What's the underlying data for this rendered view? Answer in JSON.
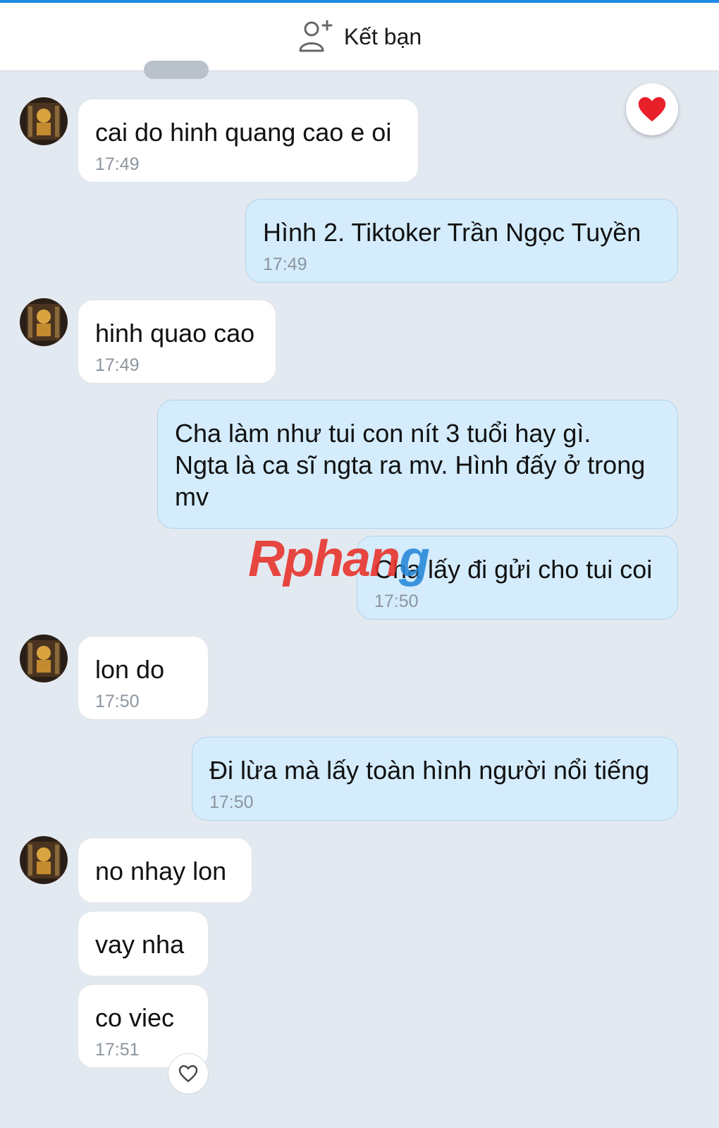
{
  "header": {
    "add_friend_label": "Kết bạn",
    "add_friend_icon": "add-friend-icon"
  },
  "colors": {
    "accent_line": "#1e88e5",
    "chat_background": "#e3e9f0",
    "incoming_bubble": "#ffffff",
    "outgoing_bubble": "#d4ecfc",
    "heart": "#e8202a"
  },
  "messages": [
    {
      "side": "in",
      "text": "cai do hinh quang cao e oi",
      "time": "17:49"
    },
    {
      "side": "out",
      "text": "Hình 2. Tiktoker Trần Ngọc Tuyền",
      "time": "17:49"
    },
    {
      "side": "in",
      "text": "hinh quao cao",
      "time": "17:49"
    },
    {
      "side": "out",
      "text": "Cha làm như tui con nít 3 tuổi hay gì.\nNgta là ca sĩ ngta ra mv. Hình đấy ở trong\nmv",
      "time": ""
    },
    {
      "side": "out",
      "text": "Cha lấy đi gửi cho tui coi",
      "time": "17:50"
    },
    {
      "side": "in",
      "text": "lon do",
      "time": "17:50"
    },
    {
      "side": "out",
      "text": "Đi lừa mà lấy toàn hình người nổi tiếng",
      "time": "17:50"
    },
    {
      "side": "in",
      "text": "no nhay lon",
      "time": ""
    },
    {
      "side": "in",
      "text": "vay nha",
      "time": ""
    },
    {
      "side": "in",
      "text": "co viec",
      "time": "17:51"
    }
  ],
  "watermark": {
    "part1": "Rphan",
    "part2": "g"
  }
}
